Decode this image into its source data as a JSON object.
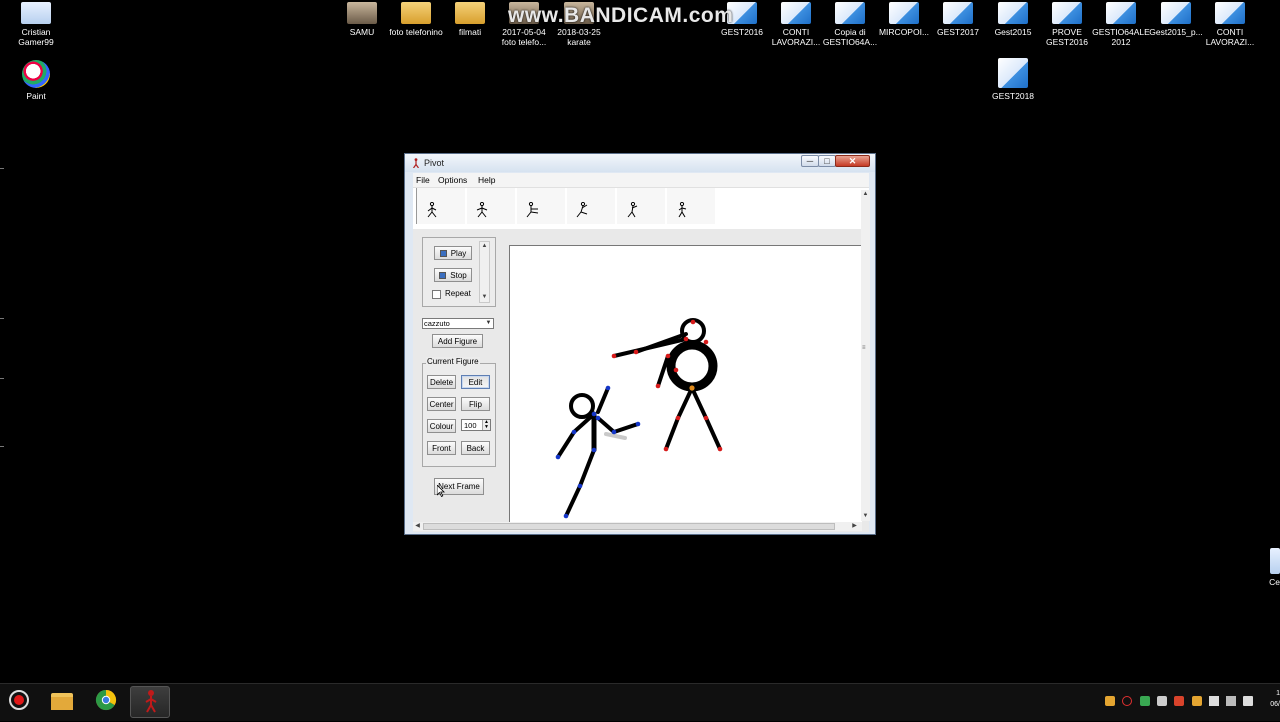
{
  "desktop": {
    "watermark": "www.BANDICAM.com",
    "icons": [
      {
        "label": "Cristian Gamer99"
      },
      {
        "label": "Paint"
      },
      {
        "label": "SAMU"
      },
      {
        "label": "foto telefonino"
      },
      {
        "label": "filmati"
      },
      {
        "label": "2017-05-04 foto telefo..."
      },
      {
        "label": "2018-03-25 karate"
      },
      {
        "label": "GEST2016"
      },
      {
        "label": "CONTI LAVORAZI..."
      },
      {
        "label": "Copia di GESTIO64A..."
      },
      {
        "label": "MIRCOPOI..."
      },
      {
        "label": "GEST2017"
      },
      {
        "label": "Gest2015"
      },
      {
        "label": "PROVE GEST2016"
      },
      {
        "label": "GESTIO64ALE 2012"
      },
      {
        "label": "Gest2015_p..."
      },
      {
        "label": "CONTI LAVORAZI..."
      },
      {
        "label": "GEST2018"
      },
      {
        "label": "Ce"
      }
    ]
  },
  "window": {
    "title": "Pivot",
    "controls": {
      "minimize": "─",
      "maximize": "□",
      "close": "✕"
    },
    "menu": [
      "File",
      "Options",
      "Help"
    ],
    "playback": {
      "play_label": "Play",
      "stop_label": "Stop",
      "repeat_label": "Repeat",
      "repeat_checked": false
    },
    "figure_select": {
      "value": "cazzuto"
    },
    "add_figure_label": "Add Figure",
    "current_figure": {
      "legend": "Current Figure",
      "delete_label": "Delete",
      "edit_label": "Edit",
      "center_label": "Center",
      "flip_label": "Flip",
      "colour_label": "Colour",
      "opacity_value": "100",
      "front_label": "Front",
      "back_label": "Back"
    },
    "next_frame_label": "Next Frame",
    "grip": "≡"
  },
  "taskbar": {
    "clock": "1\n06/"
  }
}
